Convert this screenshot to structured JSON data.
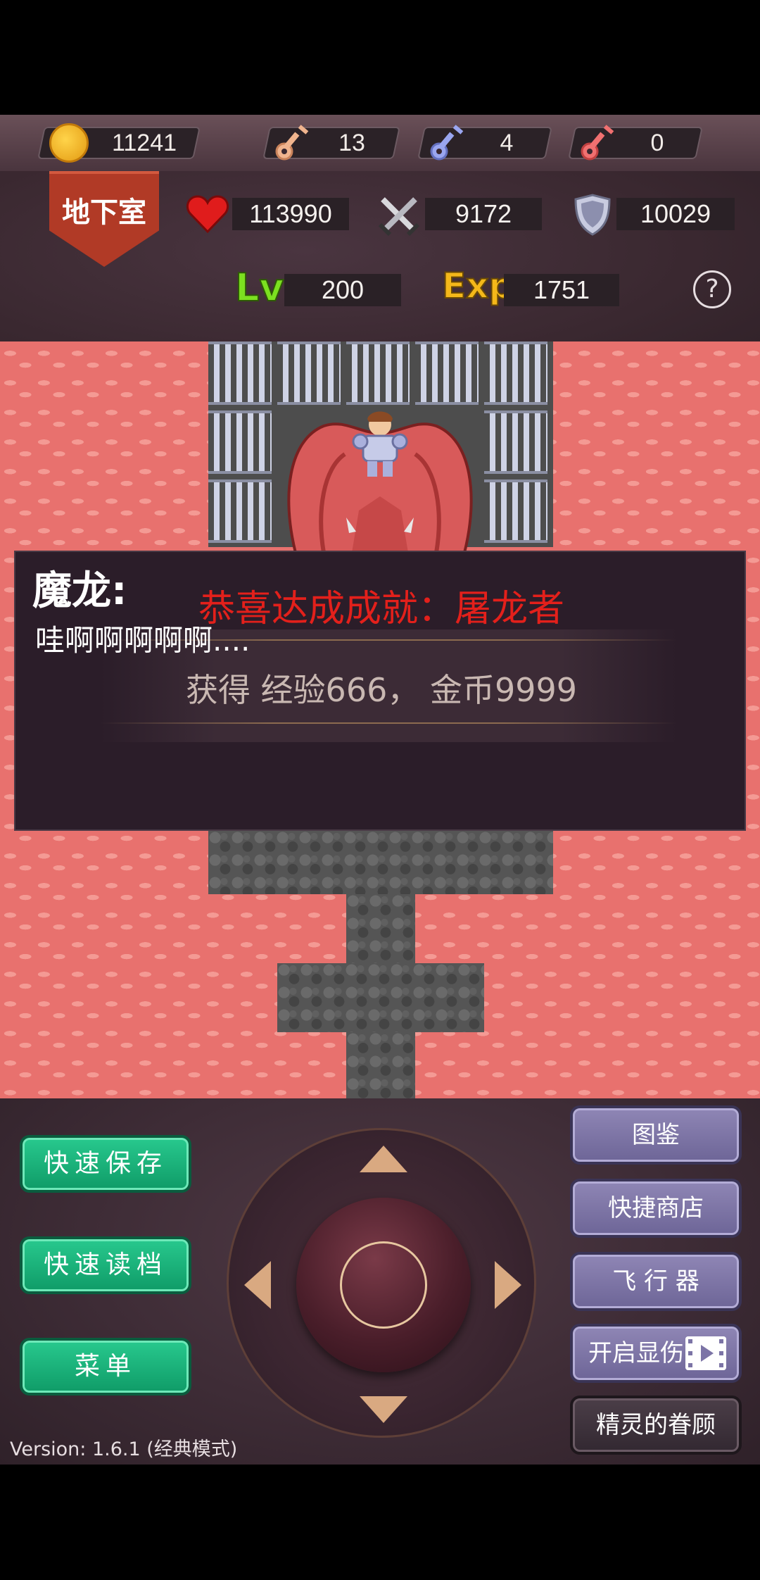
{
  "resources": {
    "gold": "11241",
    "yellow_keys": "13",
    "blue_keys": "4",
    "red_keys": "0"
  },
  "floor_name": "地下室",
  "stats": {
    "hp": "113990",
    "attack": "9172",
    "defense": "10029",
    "level_label": "Lv",
    "level": "200",
    "exp_label": "Exp",
    "exp": "1751"
  },
  "help_label": "?",
  "dialog": {
    "speaker": "魔龙:",
    "text": "哇啊啊啊啊啊....",
    "achievement": "恭喜达成成就：屠龙者",
    "reward": "获得 经验666， 金币9999"
  },
  "left_buttons": {
    "quick_save": "快速保存",
    "quick_load": "快速读档",
    "menu": "菜单"
  },
  "right_buttons": {
    "bestiary": "图鉴",
    "quick_shop": "快捷商店",
    "flyer": "飞 行 器",
    "show_damage": "开启显伤",
    "fairy_blessing": "精灵的眷顾"
  },
  "version": "Version: 1.6.1 (经典模式)",
  "colors": {
    "achievement_red": "#e3201b",
    "lava": "#e8716e",
    "green_button": "#18b47a",
    "purple_button": "#7c74a6"
  }
}
